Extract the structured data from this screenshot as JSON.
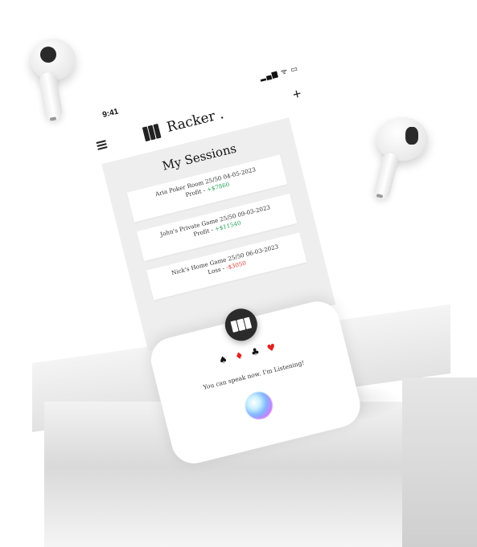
{
  "status_bar": {
    "time": "9:41",
    "icons": "▂▄▆ ᯤ ▭"
  },
  "header": {
    "app_title": "Racker .",
    "add_label": "+"
  },
  "main": {
    "page_title": "My Sessions"
  },
  "sessions": [
    {
      "title": "Aria Poker Room 25/50 04-05-2023",
      "result_label": "Profit - ",
      "amount": "+$7860",
      "kind": "profit"
    },
    {
      "title": "John's Private Game 25/50 09-03-2023",
      "result_label": "Profit - ",
      "amount": "+$11540",
      "kind": "profit"
    },
    {
      "title": "Nick's Home Game 25/50 06-03-2023",
      "result_label": "Loss - ",
      "amount": "-$3050",
      "kind": "loss"
    }
  ],
  "pager": {
    "count": 3,
    "active_index": 0
  },
  "voice": {
    "suits": [
      "♠",
      "♦",
      "♣",
      "♥"
    ],
    "message": "You can speak now. I'm Listening!"
  },
  "colors": {
    "profit": "#29a35a",
    "loss": "#e0403a",
    "accent_dark": "#2b2b2b"
  }
}
